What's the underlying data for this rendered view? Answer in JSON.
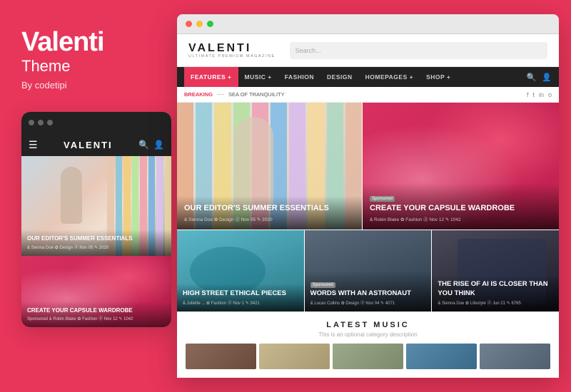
{
  "left": {
    "title": "Valenti",
    "subtitle": "Theme",
    "by": "By codetipi",
    "mobile": {
      "logo": "VALENTI",
      "hero_title": "OUR EDITOR'S SUMMER ESSENTIALS",
      "hero_meta": "& Sienna Doe  ✿ Design  ⓓ Nov 05  ✎ 2020",
      "card2_title": "CREATE YOUR CAPSULE WARDROBE",
      "card2_meta": "Sponsored  & Robin Blake  ✿ Fashion  ⓓ Nov 12  ✎ 1042"
    }
  },
  "browser": {
    "logo": "VALENTI",
    "logo_sub": "ULTIMATE PREMIUM MAGAZINE",
    "search_placeholder": "Search...",
    "nav": {
      "items": [
        {
          "label": "FEATURES +",
          "active": true
        },
        {
          "label": "MUSIC +",
          "active": false
        },
        {
          "label": "FASHION",
          "active": false
        },
        {
          "label": "DESIGN",
          "active": false
        },
        {
          "label": "HOMEPAGES +",
          "active": false
        },
        {
          "label": "SHOP +",
          "active": false
        }
      ]
    },
    "breaking": {
      "label": "BREAKING",
      "separator": "—",
      "text": "SEA OF TRANQUILITY"
    },
    "social": [
      "f",
      "t",
      "in",
      "o"
    ],
    "hero1": {
      "title": "OUR EDITOR'S SUMMER ESSENTIALS",
      "meta": "& Sienna Doe  ✿ Design  ⓓ Nov 05  ✎ 2020"
    },
    "hero2": {
      "title": "CREATE YOUR CAPSULE WARDROBE",
      "sponsored": "Sponsored",
      "meta": "& Robin Blake  ✿ Fashion  ⓓ Nov 12  ✎ 1042"
    },
    "bottom_cards": [
      {
        "title": "HIGH STREET ETHICAL PIECES",
        "meta": "& Juliette ...  ✿ Fashion  ⓓ Nov 1  ✎ 3421"
      },
      {
        "title": "WORDS WITH AN ASTRONAUT",
        "sponsored": "Sponsored",
        "meta": "& Lucas Collins  ✿ Design  ⓓ Nov 04  ✎ 4071"
      },
      {
        "title": "THE RISE OF AI IS CLOSER THAN YOU THINK",
        "meta": "& Sienna Doe  ✿ Lifestyle  ⓓ Jun 21  ✎ 6765"
      }
    ],
    "music_section": {
      "title": "LATEST MUSIC",
      "description": "This is an optional category description"
    }
  }
}
